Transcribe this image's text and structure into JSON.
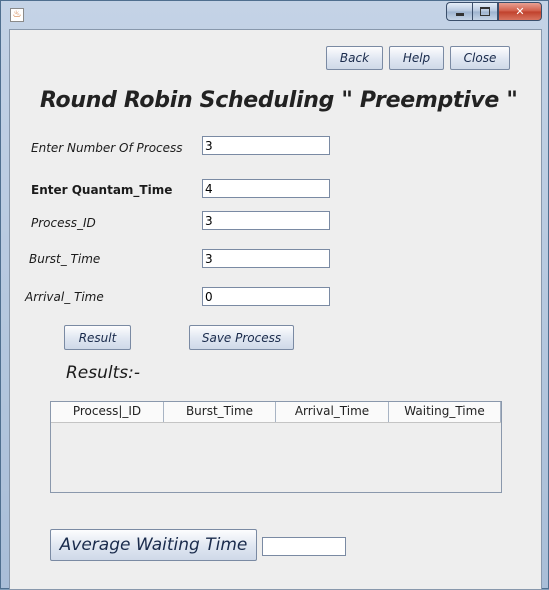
{
  "window": {
    "app_icon": "java-cup-icon",
    "controls": [
      "minimize-icon",
      "maximize-icon",
      "close-icon"
    ]
  },
  "toolbar": {
    "back_label": "Back",
    "help_label": "Help",
    "close_label": "Close"
  },
  "title": "Round Robin Scheduling \" Preemptive \"",
  "form": {
    "num_process_label": "Enter Number Of Process",
    "num_process_value": "3",
    "quantum_label": "Enter Quantam_Time",
    "quantum_value": "4",
    "process_id_label": "Process_ID",
    "process_id_value": "3",
    "burst_label": "Burst_ Time",
    "burst_value": "3",
    "arrival_label": "Arrival_ Time",
    "arrival_value": "0"
  },
  "actions": {
    "result_label": "Result",
    "save_label": "Save Process"
  },
  "results": {
    "heading": "Results:-",
    "columns": [
      "Process|_ID",
      "Burst_Time",
      "Arrival_Time",
      "Waiting_Time"
    ],
    "rows": []
  },
  "average": {
    "button_label": "Average Waiting Time",
    "value": ""
  }
}
